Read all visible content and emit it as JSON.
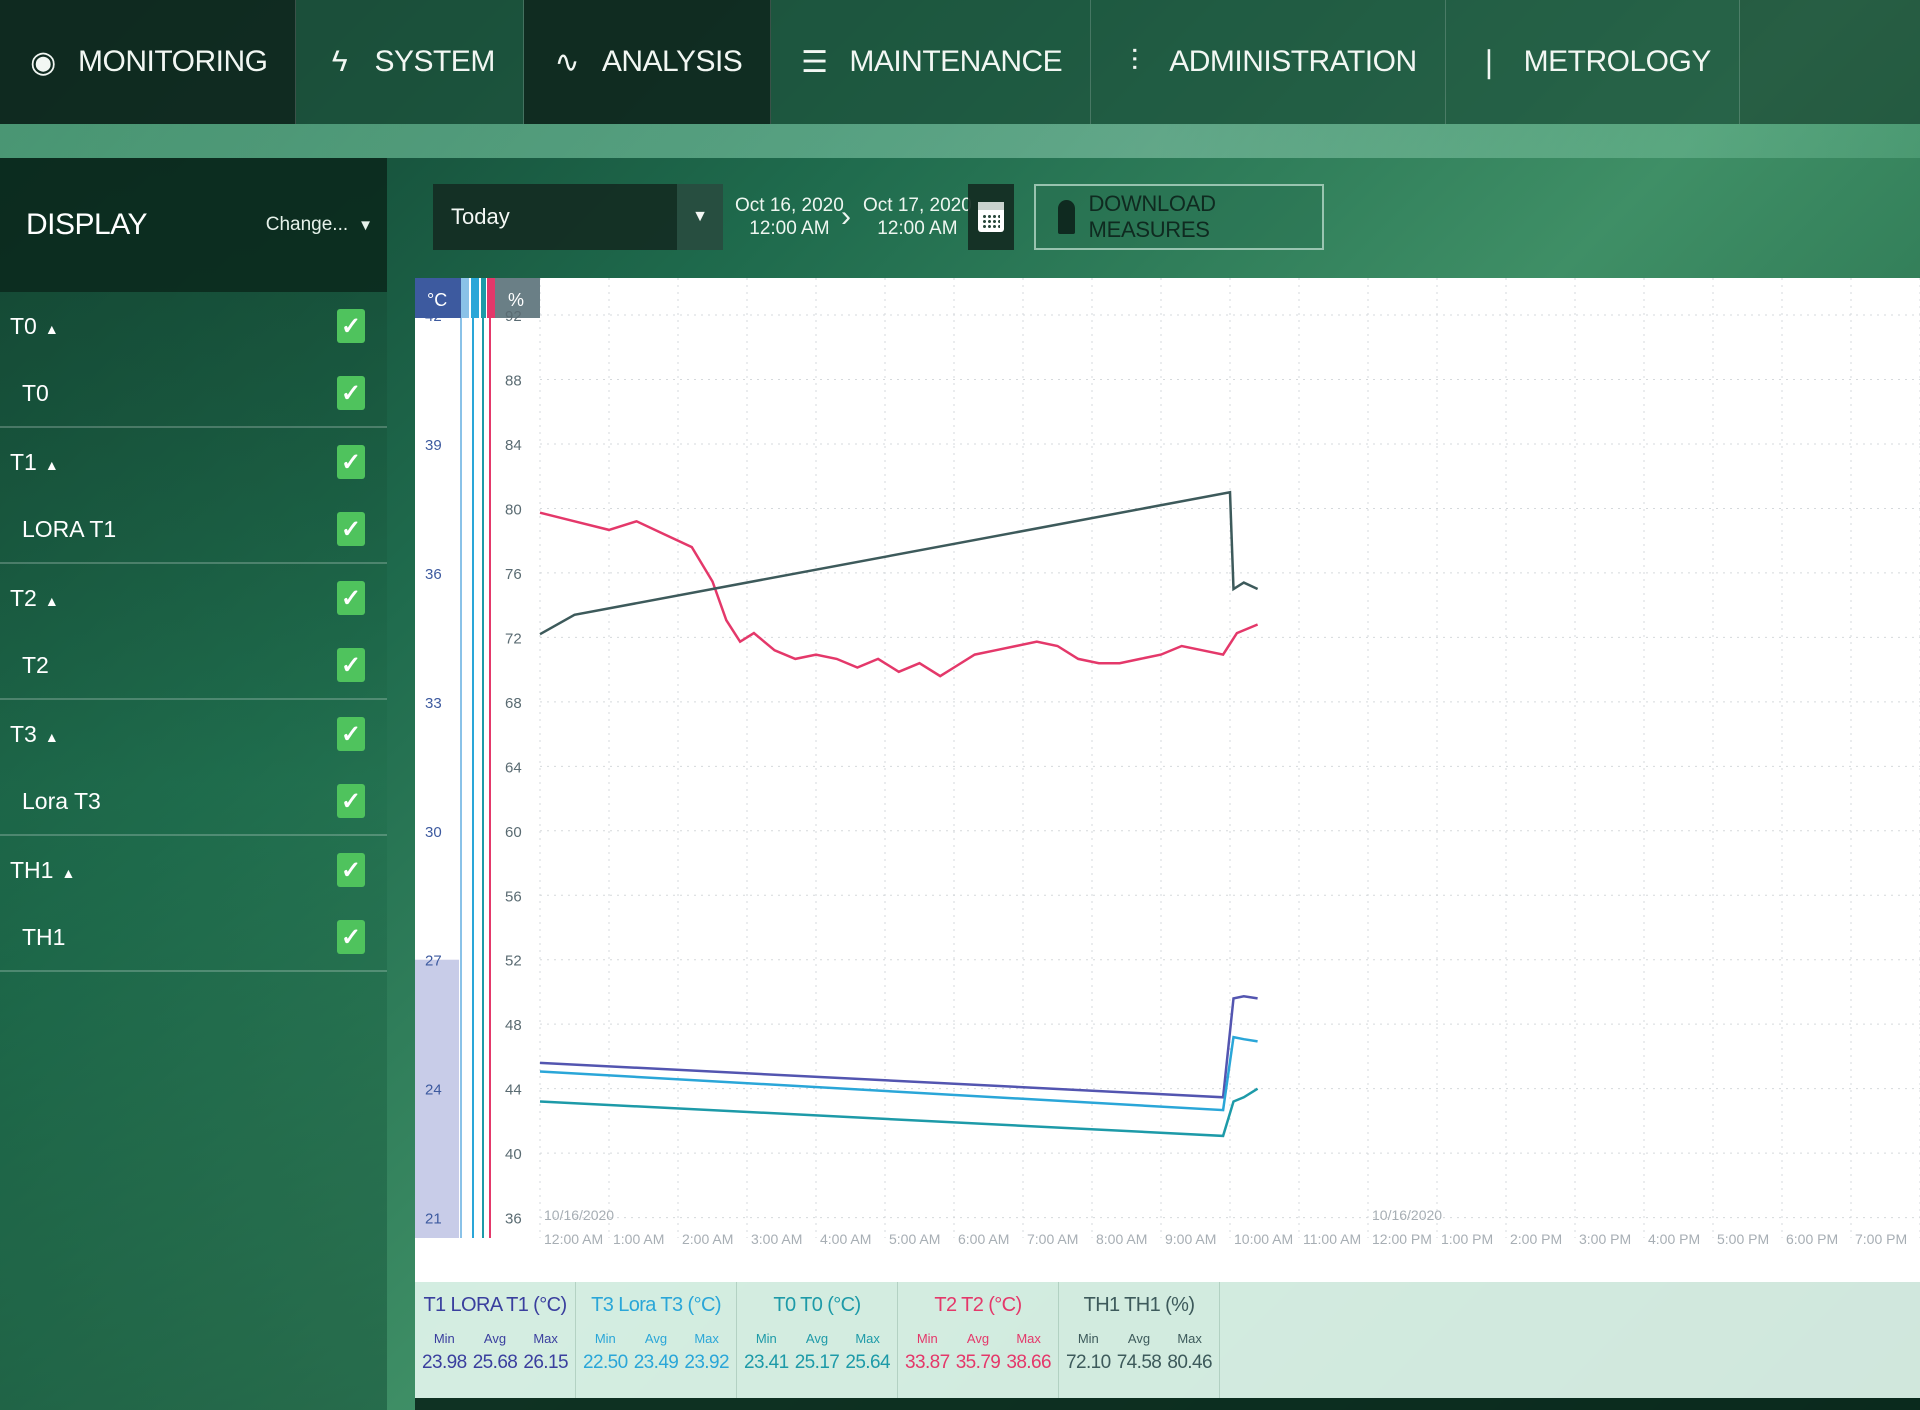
{
  "nav": {
    "items": [
      {
        "label": "MONITORING",
        "icon": "eye-icon",
        "glyph": "◉"
      },
      {
        "label": "SYSTEM",
        "icon": "lightning-icon",
        "glyph": "ϟ"
      },
      {
        "label": "ANALYSIS",
        "icon": "analysis-chart-icon",
        "glyph": "∿"
      },
      {
        "label": "MAINTENANCE",
        "icon": "server-icon",
        "glyph": "☰"
      },
      {
        "label": "ADMINISTRATION",
        "icon": "sliders-icon",
        "glyph": "⫶"
      },
      {
        "label": "METROLOGY",
        "icon": "thermometer-icon",
        "glyph": "❘"
      }
    ]
  },
  "sidebar": {
    "title": "DISPLAY",
    "change_label": "Change...",
    "groups": [
      {
        "label": "T0",
        "child": "T0"
      },
      {
        "label": "T1",
        "child": "LORA T1"
      },
      {
        "label": "T2",
        "child": "T2"
      },
      {
        "label": "T3",
        "child": "Lora T3"
      },
      {
        "label": "TH1",
        "child": "TH1"
      }
    ]
  },
  "toolbar": {
    "period": "Today",
    "date_from": {
      "day": "Oct 16, 2020",
      "time": "12:00 AM"
    },
    "date_to": {
      "day": "Oct 17, 2020",
      "time": "12:00 AM"
    },
    "download_label": "DOWNLOAD MEASURES"
  },
  "chart_data": {
    "type": "line",
    "x_labels": [
      "12:00 AM",
      "1:00 AM",
      "2:00 AM",
      "3:00 AM",
      "4:00 AM",
      "5:00 AM",
      "6:00 AM",
      "7:00 AM",
      "8:00 AM",
      "9:00 AM",
      "10:00 AM",
      "11:00 AM",
      "12:00 PM",
      "1:00 PM",
      "2:00 PM",
      "3:00 PM",
      "4:00 PM",
      "5:00 PM",
      "6:00 PM",
      "7:00 PM"
    ],
    "date_labels": [
      {
        "label": "10/16/2020",
        "at_hour": 0
      },
      {
        "label": "10/16/2020",
        "at_hour": 12
      }
    ],
    "y_left": {
      "unit": "°C",
      "ticks": [
        42,
        39,
        36,
        33,
        30,
        27,
        24,
        21
      ],
      "range": [
        20,
        42
      ]
    },
    "y_right": {
      "unit": "%",
      "ticks": [
        92,
        88,
        84,
        80,
        76,
        72,
        68,
        64,
        60,
        56,
        52,
        48,
        44,
        40,
        36
      ],
      "range": [
        35,
        92
      ]
    },
    "series": [
      {
        "name": "T1 LORA T1 (°C)",
        "color": "#5355b0",
        "axis": "left",
        "points": [
          [
            0.0,
            24.6
          ],
          [
            9.9,
            23.8
          ],
          [
            10.05,
            26.1
          ],
          [
            10.2,
            26.15
          ],
          [
            10.4,
            26.1
          ]
        ]
      },
      {
        "name": "T3 Lora T3 (°C)",
        "color": "#2aa6d8",
        "axis": "left",
        "points": [
          [
            0.0,
            24.4
          ],
          [
            9.9,
            23.5
          ],
          [
            10.05,
            25.2
          ],
          [
            10.2,
            25.15
          ],
          [
            10.4,
            25.1
          ]
        ]
      },
      {
        "name": "T0 T0 (°C)",
        "color": "#1d9aa8",
        "axis": "left",
        "points": [
          [
            0.0,
            23.7
          ],
          [
            9.9,
            22.9
          ],
          [
            10.05,
            23.7
          ],
          [
            10.2,
            23.8
          ],
          [
            10.4,
            24.0
          ]
        ]
      },
      {
        "name": "T2 T2 (°C)",
        "color": "#e4386a",
        "axis": "left",
        "points": [
          [
            0.0,
            37.4
          ],
          [
            0.5,
            37.2
          ],
          [
            1.0,
            37.0
          ],
          [
            1.4,
            37.2
          ],
          [
            1.8,
            36.9
          ],
          [
            2.2,
            36.6
          ],
          [
            2.5,
            35.8
          ],
          [
            2.7,
            34.9
          ],
          [
            2.9,
            34.4
          ],
          [
            3.1,
            34.6
          ],
          [
            3.4,
            34.2
          ],
          [
            3.7,
            34.0
          ],
          [
            4.0,
            34.1
          ],
          [
            4.3,
            34.0
          ],
          [
            4.6,
            33.8
          ],
          [
            4.9,
            34.0
          ],
          [
            5.2,
            33.7
          ],
          [
            5.5,
            33.9
          ],
          [
            5.8,
            33.6
          ],
          [
            6.0,
            33.8
          ],
          [
            6.3,
            34.1
          ],
          [
            6.6,
            34.2
          ],
          [
            6.9,
            34.3
          ],
          [
            7.2,
            34.4
          ],
          [
            7.5,
            34.3
          ],
          [
            7.8,
            34.0
          ],
          [
            8.1,
            33.9
          ],
          [
            8.4,
            33.9
          ],
          [
            8.7,
            34.0
          ],
          [
            9.0,
            34.1
          ],
          [
            9.3,
            34.3
          ],
          [
            9.6,
            34.2
          ],
          [
            9.9,
            34.1
          ],
          [
            10.1,
            34.6
          ],
          [
            10.4,
            34.8
          ]
        ]
      },
      {
        "name": "TH1 TH1 (%)",
        "color": "#3d5a5b",
        "axis": "right",
        "points": [
          [
            0.0,
            72.2
          ],
          [
            0.5,
            73.4
          ],
          [
            10.0,
            81.0
          ],
          [
            10.05,
            75.0
          ],
          [
            10.2,
            75.4
          ],
          [
            10.4,
            75.0
          ]
        ]
      }
    ]
  },
  "stats": [
    {
      "title": "T1 LORA T1 (°C)",
      "color": "#3a3f9e",
      "min": "23.98",
      "avg": "25.68",
      "max": "26.15"
    },
    {
      "title": "T3 Lora T3 (°C)",
      "color": "#2aa6d8",
      "min": "22.50",
      "avg": "23.49",
      "max": "23.92"
    },
    {
      "title": "T0 T0 (°C)",
      "color": "#1d9aa8",
      "min": "23.41",
      "avg": "25.17",
      "max": "25.64"
    },
    {
      "title": "T2 T2 (°C)",
      "color": "#e4386a",
      "min": "33.87",
      "avg": "35.79",
      "max": "38.66"
    },
    {
      "title": "TH1 TH1 (%)",
      "color": "#3d5a5b",
      "min": "72.10",
      "avg": "74.58",
      "max": "80.46"
    }
  ],
  "stat_labels": {
    "min": "Min",
    "avg": "Avg",
    "max": "Max"
  }
}
